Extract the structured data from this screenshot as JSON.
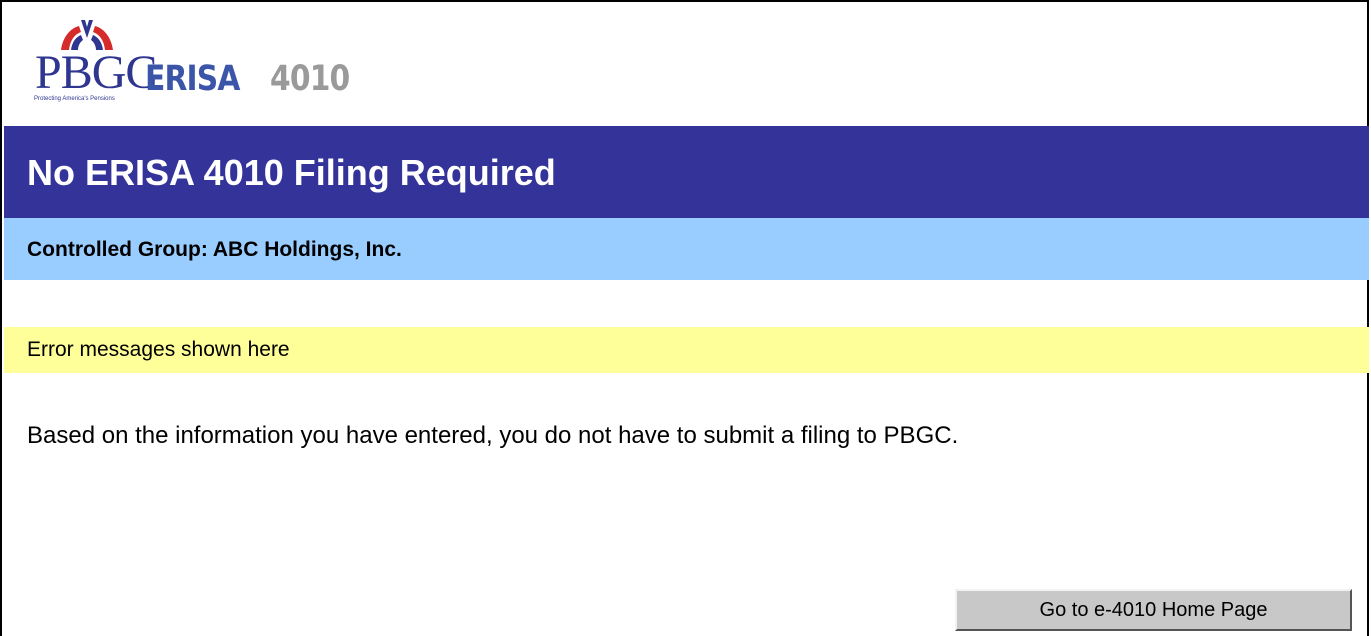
{
  "logo": {
    "org_name": "PBGC",
    "tagline": "Protecting America's Pensions",
    "product_word": "ERISA",
    "product_number": "4010"
  },
  "header": {
    "title": "No ERISA 4010 Filing Required"
  },
  "controlled_group": {
    "label": "Controlled Group: ABC Holdings, Inc."
  },
  "error_area": {
    "text": "Error messages shown here"
  },
  "main": {
    "message": "Based on the information you have entered, you do not have to submit a filing to PBGC."
  },
  "actions": {
    "home_button_label": "Go to e-4010 Home Page"
  },
  "colors": {
    "title_bar": "#333399",
    "group_bar": "#99ccff",
    "error_bar": "#ffff99",
    "logo_blue": "#2e3690",
    "logo_red": "#d62b2b"
  }
}
